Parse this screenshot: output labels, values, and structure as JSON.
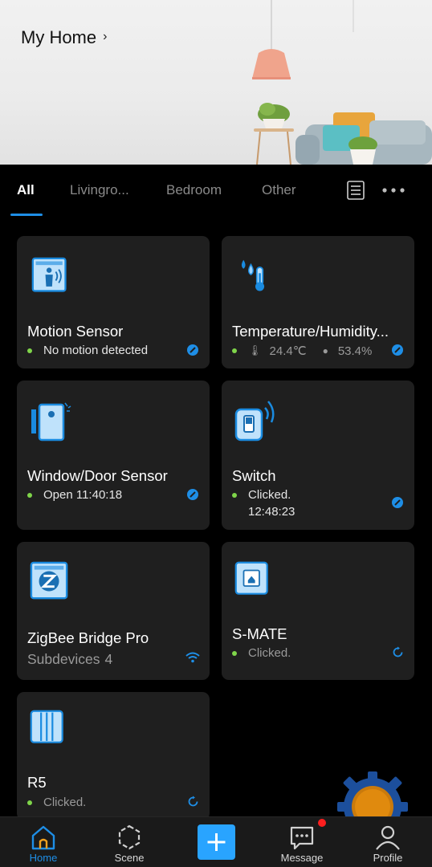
{
  "header": {
    "title": "My Home",
    "chevron": "›"
  },
  "tabs": [
    {
      "label": "All",
      "active": true
    },
    {
      "label": "Livingro..."
    },
    {
      "label": "Bedroom"
    },
    {
      "label": "Other"
    }
  ],
  "toolbar": {
    "list_icon": "list-view-icon",
    "more_icon": "more-icon"
  },
  "devices": [
    {
      "name": "Motion Sensor",
      "status": "No motion detected",
      "icon": "motion-sensor-icon",
      "badge": "zigbee-badge-icon"
    },
    {
      "name": "Temperature/Humidity...",
      "temperature": "24.4℃",
      "humidity": "53.4%",
      "icon": "temperature-humidity-icon",
      "badge": "zigbee-badge-icon"
    },
    {
      "name": "Window/Door Sensor",
      "status": "Open 11:40:18",
      "icon": "door-sensor-icon",
      "badge": "zigbee-badge-icon"
    },
    {
      "name": "Switch",
      "status_line1": "Clicked.",
      "status_line2": "12:48:23",
      "icon": "wireless-switch-icon",
      "badge": "zigbee-badge-icon"
    },
    {
      "name": "ZigBee Bridge Pro",
      "subdevices_label": "Subdevices",
      "subdevices_count": "4",
      "icon": "zigbee-bridge-icon",
      "badge": "wifi-icon"
    },
    {
      "name": "S-MATE",
      "status": "Clicked.",
      "icon": "s-mate-icon",
      "badge": "refresh-badge-icon"
    },
    {
      "name": "R5",
      "status": "Clicked.",
      "icon": "r5-switch-icon",
      "badge": "refresh-badge-icon"
    }
  ],
  "bottom_nav": [
    {
      "label": "Home",
      "icon": "home-icon",
      "active": true
    },
    {
      "label": "Scene",
      "icon": "scene-icon"
    },
    {
      "label": "",
      "icon": "add-icon"
    },
    {
      "label": "Message",
      "icon": "message-icon",
      "unread": true
    },
    {
      "label": "Profile",
      "icon": "profile-icon"
    }
  ],
  "colors": {
    "accent": "#1e8ee6",
    "online": "#7fd54a",
    "card_bg": "#1f1f1f",
    "unread": "#ff1f1f"
  }
}
